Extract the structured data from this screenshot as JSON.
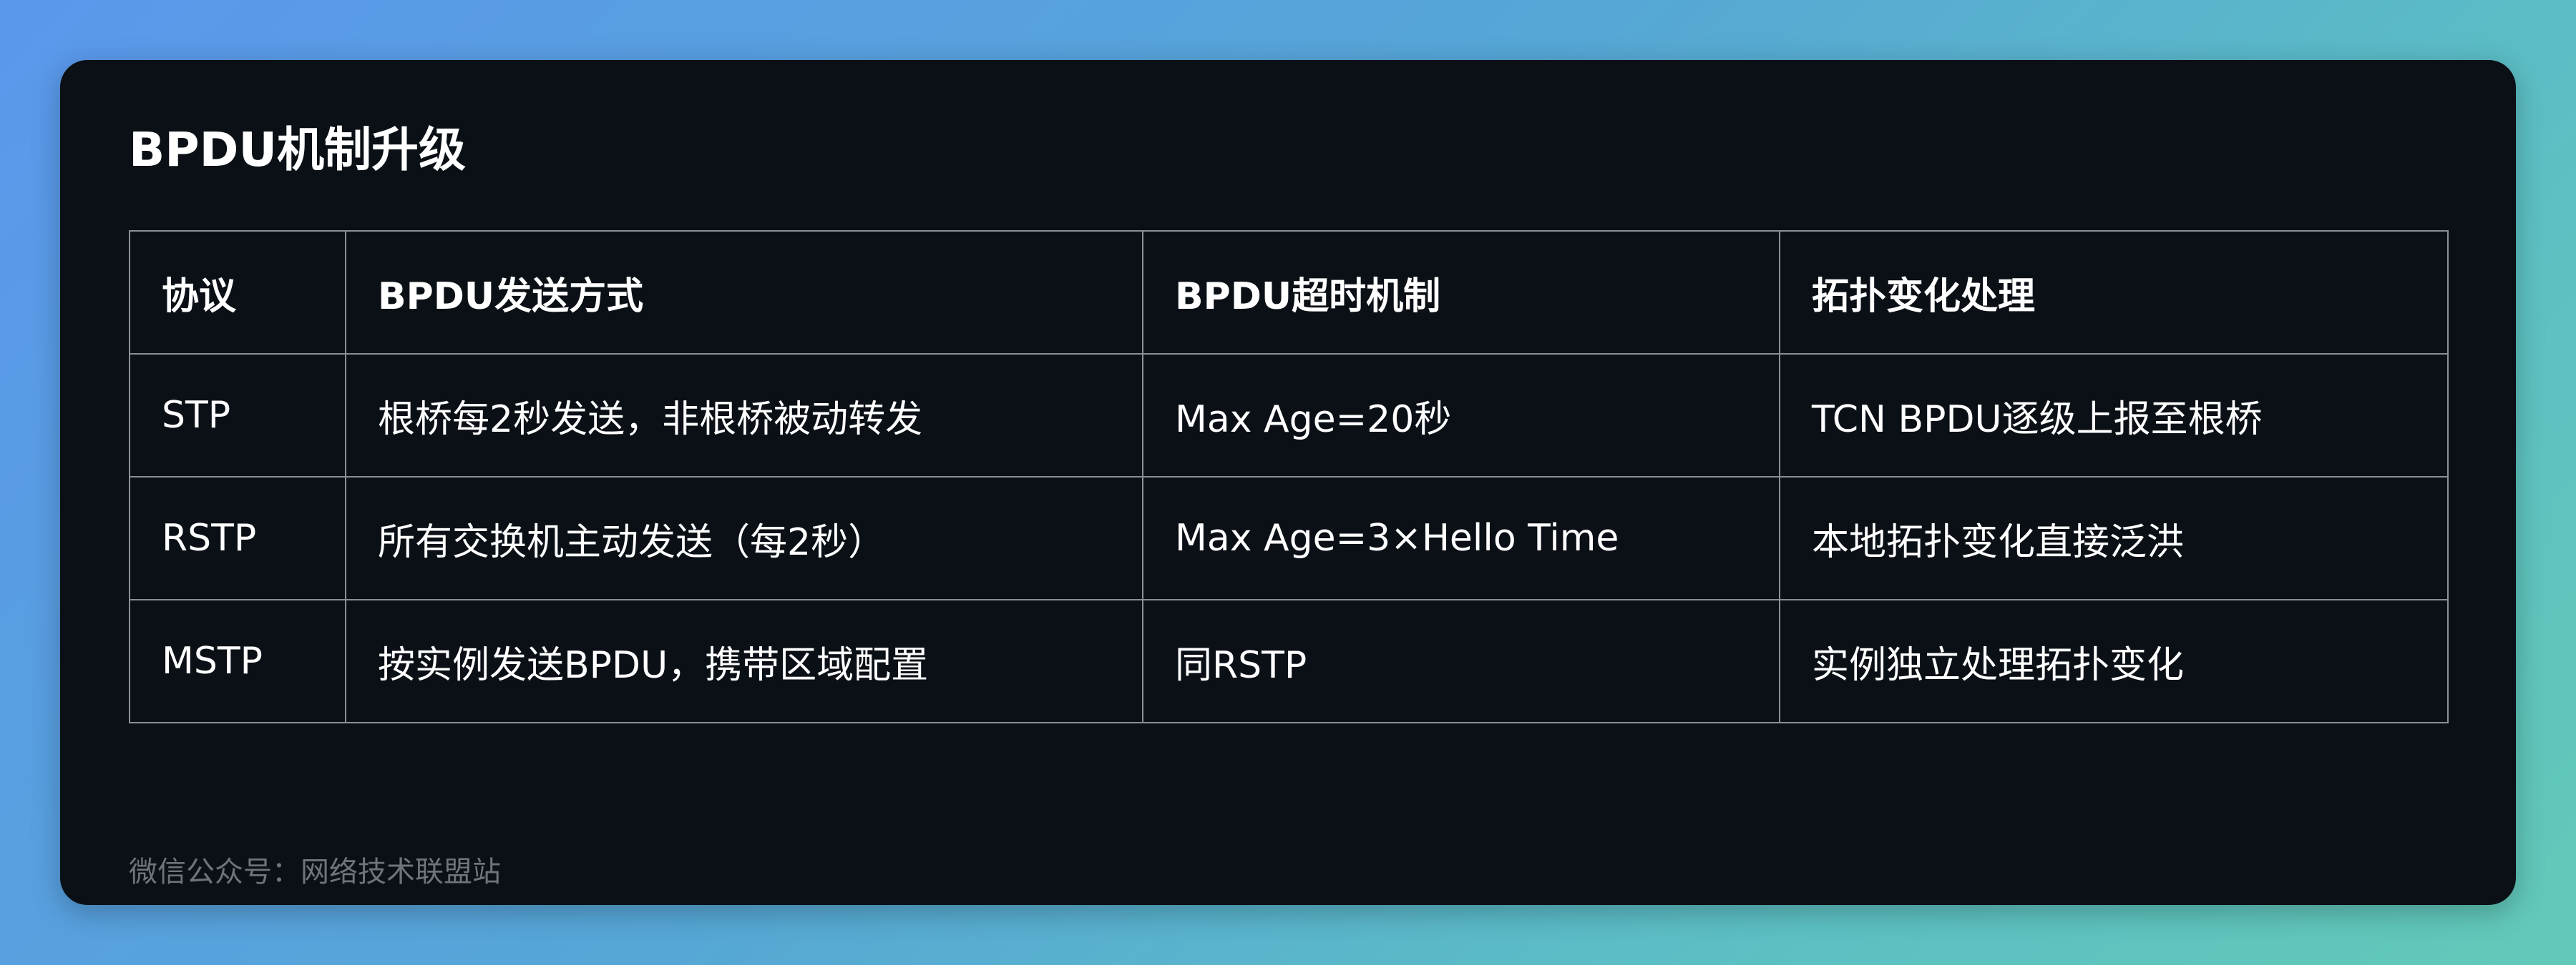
{
  "title": "BPDU机制升级",
  "table": {
    "headers": [
      "协议",
      "BPDU发送方式",
      "BPDU超时机制",
      "拓扑变化处理"
    ],
    "rows": [
      [
        "STP",
        "根桥每2秒发送，非根桥被动转发",
        "Max Age=20秒",
        "TCN BPDU逐级上报至根桥"
      ],
      [
        "RSTP",
        "所有交换机主动发送（每2秒）",
        "Max Age=3×Hello Time",
        "本地拓扑变化直接泛洪"
      ],
      [
        "MSTP",
        "按实例发送BPDU，携带区域配置",
        "同RSTP",
        "实例独立处理拓扑变化"
      ]
    ]
  },
  "footer": "微信公众号：网络技术联盟站",
  "colors": {
    "background_gradient_start": "#5a98ec",
    "background_gradient_end": "#62c9b8",
    "card": "#0a1016",
    "text": "#ffffff",
    "grid_line": "#8a9097",
    "footer_text": "#6e747a"
  }
}
